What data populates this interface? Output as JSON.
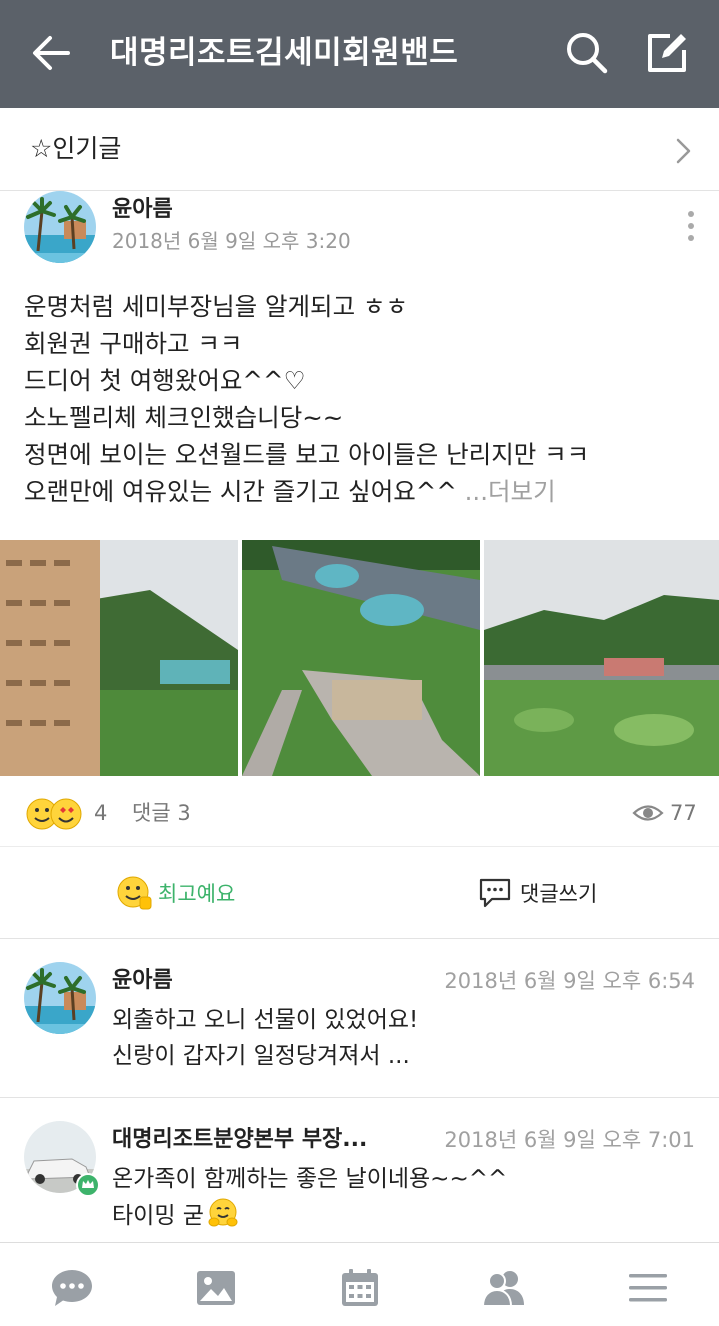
{
  "header": {
    "title": "대명리조트김세미회원밴드",
    "bg_color": "#5b6169"
  },
  "popular": {
    "label": "☆인기글"
  },
  "post": {
    "author": "윤아름",
    "time": "2018년 6월 9일 오후 3:20",
    "lines": [
      "운명처럼 세미부장님을 알게되고 ㅎㅎ",
      "회원권 구매하고 ㅋㅋ",
      "드디어 첫 여행왔어요^^♡",
      "소노펠리체 체크인했습니당~~",
      "정면에 보이는 오션월드를 보고 아이들은 난리지만 ㅋㅋ",
      "오랜만에 여유있는 시간 즐기고 싶어요^^ "
    ],
    "more_label": "...더보기",
    "reaction_count": "4",
    "comment_count": "댓글 3",
    "views": "77"
  },
  "actions": {
    "like_label": "최고예요",
    "comment_label": "댓글쓰기",
    "like_color": "#3db36b"
  },
  "comments": [
    {
      "author": "윤아름",
      "time": "2018년 6월 9일 오후 6:54",
      "lines": [
        "외출하고 오니 선물이 있었어요!",
        "신랑이 갑자기 일정당겨져서 ..."
      ]
    },
    {
      "author": "대명리조트분양본부 부장...",
      "time": "2018년 6월 9일 오후 7:01",
      "lines": [
        "온가족이 함께하는 좋은 날이네용~~^^",
        "타이밍 굳"
      ]
    }
  ],
  "bottom_nav": [
    "chat-icon",
    "photo-icon",
    "calendar-icon",
    "members-icon",
    "menu-icon"
  ]
}
